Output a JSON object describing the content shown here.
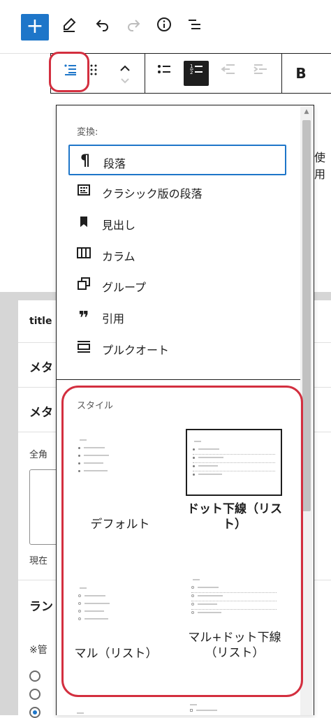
{
  "toolbar": {
    "add_label": "+",
    "icons": [
      "plus-icon",
      "pencil-icon",
      "undo-icon",
      "redo-icon",
      "info-icon",
      "list-view-icon"
    ]
  },
  "block_toolbar": {
    "bold_label": "B",
    "icons": [
      "list-block-icon",
      "drag-handle-icon",
      "move-up-down-icon",
      "unordered-list-icon",
      "ordered-list-icon",
      "outdent-icon",
      "indent-icon",
      "bold-icon"
    ]
  },
  "background": {
    "row1": "title",
    "row2": "メタ",
    "row3": "メタ",
    "row4": "全角",
    "row5": "現在",
    "row6": "ラン",
    "row7": "※管",
    "right_text": "使用"
  },
  "popover": {
    "transform_title": "変換:",
    "items": [
      {
        "label": "段落",
        "icon": "paragraph-icon"
      },
      {
        "label": "クラシック版の段落",
        "icon": "classic-icon"
      },
      {
        "label": "見出し",
        "icon": "bookmark-icon"
      },
      {
        "label": "カラム",
        "icon": "columns-icon"
      },
      {
        "label": "グループ",
        "icon": "group-icon"
      },
      {
        "label": "引用",
        "icon": "quote-icon"
      },
      {
        "label": "プルクオート",
        "icon": "pullquote-icon"
      }
    ],
    "styles_title": "スタイル",
    "styles": [
      {
        "label": "デフォルト"
      },
      {
        "label": "ドット下線（リスト）"
      },
      {
        "label": "マル（リスト）"
      },
      {
        "label": "マル+ドット下線（リスト）"
      }
    ]
  },
  "colors": {
    "accent": "#1e76c9",
    "highlight": "#d32f3f"
  }
}
